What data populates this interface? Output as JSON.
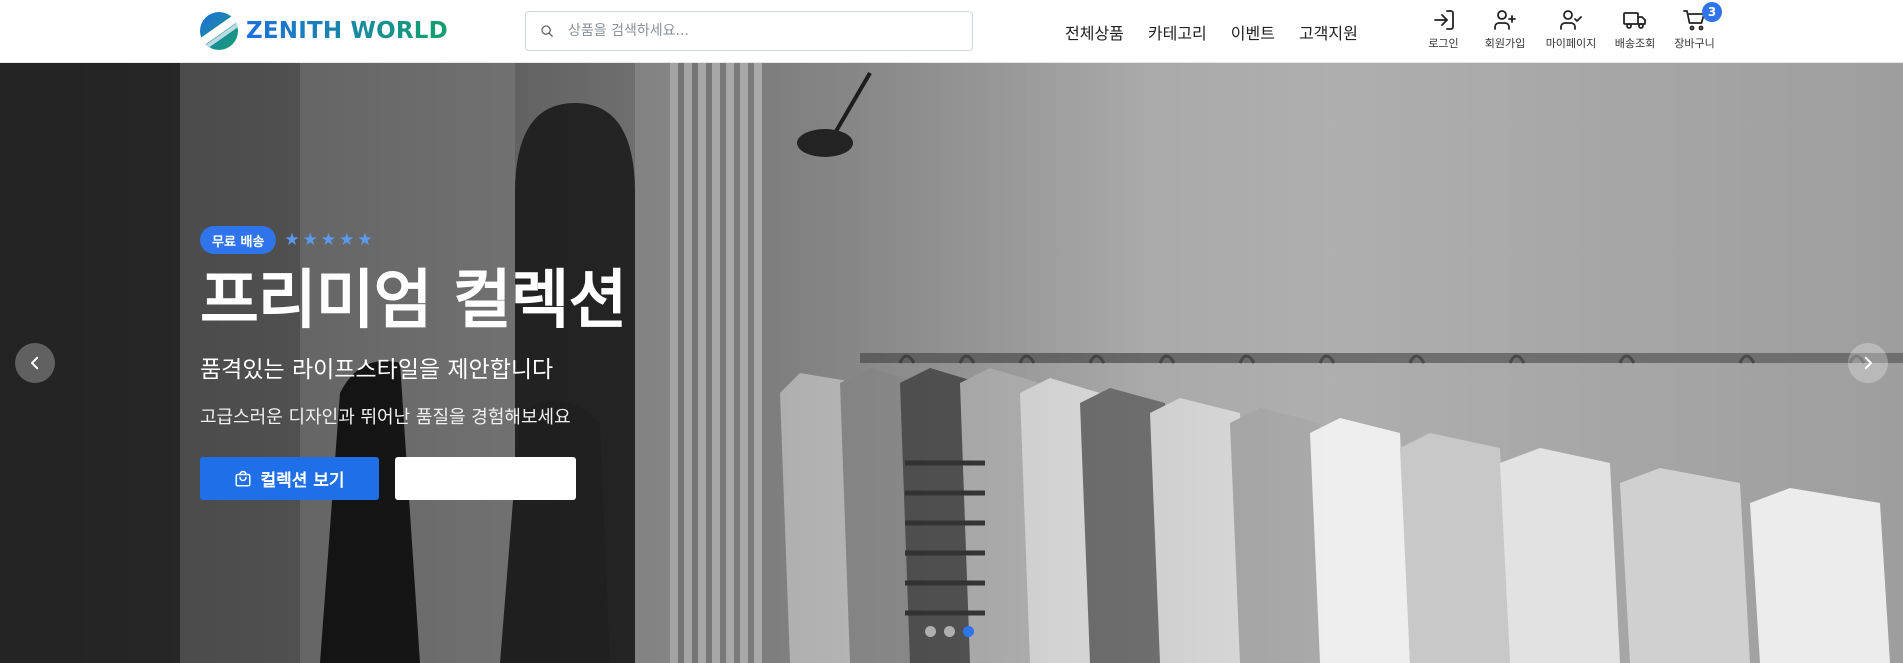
{
  "brand": {
    "name": "ZENITH WORLD"
  },
  "search": {
    "placeholder": "상품을 검색하세요..."
  },
  "nav": [
    "전체상품",
    "카테고리",
    "이벤트",
    "고객지원"
  ],
  "utilities": [
    {
      "label": "로그인",
      "icon": "login-icon"
    },
    {
      "label": "회원가입",
      "icon": "user-plus-icon"
    },
    {
      "label": "마이페이지",
      "icon": "user-check-icon"
    },
    {
      "label": "배송조회",
      "icon": "truck-icon"
    },
    {
      "label": "장바구니",
      "icon": "cart-icon",
      "badge": "3"
    }
  ],
  "hero": {
    "badge": "무료 배송",
    "stars": 5,
    "title": "프리미엄 컬렉션",
    "subtitle": "품격있는 라이프스타일을 제안합니다",
    "description": "고급스러운 디자인과 뛰어난 품질을 경험해보세요",
    "primary_button": "컬렉션 보기",
    "secondary_button": "",
    "slides": 3,
    "active_slide": 3
  },
  "colors": {
    "accent": "#2f74ea",
    "brand_blue": "#1d6fe0",
    "brand_green": "#14a06b"
  }
}
